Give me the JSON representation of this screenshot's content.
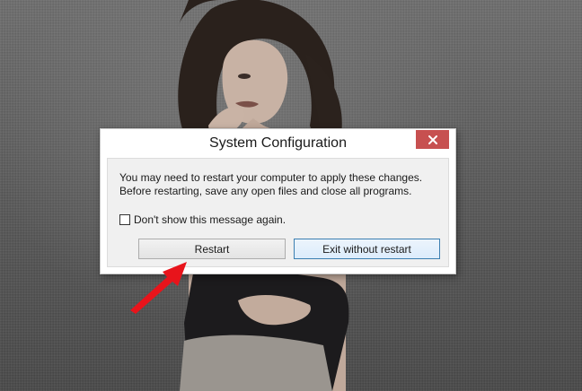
{
  "dialog": {
    "title": "System Configuration",
    "message_line_1": "You may need to restart your computer to apply these changes.",
    "message_line_2": "Before restarting, save any open files and close all programs.",
    "checkbox_label": "Don't show this message again.",
    "checkbox_checked": false,
    "restart_label": "Restart",
    "exit_label": "Exit without restart",
    "close_icon": "close-icon"
  },
  "annotation": {
    "arrow_color": "#e8141b"
  },
  "colors": {
    "close_button": "#c75050",
    "default_button_border": "#3c7fb1"
  }
}
